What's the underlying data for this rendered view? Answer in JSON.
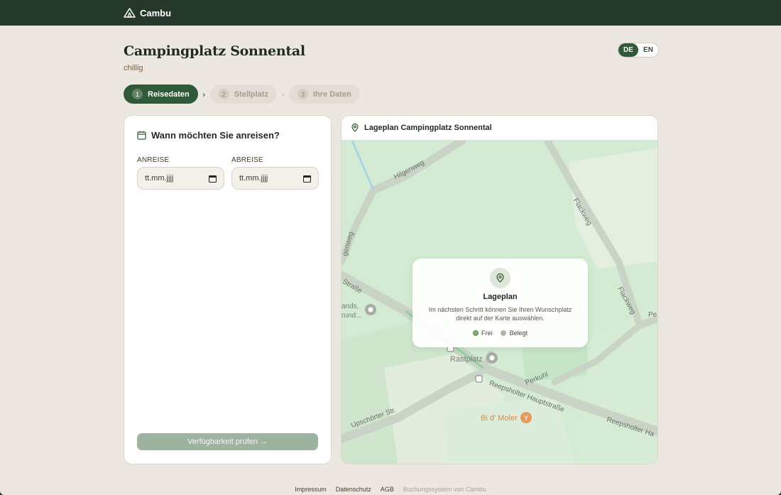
{
  "app": {
    "brand": "Cambu"
  },
  "page": {
    "title": "Campingplatz Sonnental",
    "subtitle": "chillig"
  },
  "lang": {
    "options": [
      "DE",
      "EN"
    ],
    "active": "DE"
  },
  "steps": [
    {
      "num": "1",
      "label": "Reisedaten",
      "state": "active"
    },
    {
      "num": "2",
      "label": "Stellplatz",
      "state": "inactive"
    },
    {
      "num": "3",
      "label": "Ihre Daten",
      "state": "inactive"
    }
  ],
  "dates": {
    "heading": "Wann möchten Sie anreisen?",
    "arrival_label": "ANREISE",
    "arrival_value": "tt.mm.jjjj",
    "departure_label": "ABREISE",
    "departure_value": "tt.mm.jjjj",
    "check_button": "Verfügbarkeit prüfen →"
  },
  "map": {
    "header": "Lageplan Campingplatz Sonnental",
    "streets": [
      "Hilgenweg",
      "Flackweg",
      "Flackweg",
      "Straße",
      "Perkuhl",
      "Reepsholter Hauptstraße",
      "Reepsholter Ha",
      "Upschörter Str.",
      "Pe",
      "genweg"
    ],
    "pois": [
      "Rastplatz",
      "Bi d' Moler",
      "ands,",
      "rund..."
    ],
    "overlay": {
      "title": "Lageplan",
      "text": "Im nächsten Schritt können Sie Ihren Wunschplatz direkt auf der Karte auswählen.",
      "legend_free": "Frei",
      "legend_taken": "Belegt"
    }
  },
  "colors": {
    "accent": "#2f5a37",
    "free": "#7fae6f",
    "taken": "#b8b2a6"
  },
  "footer": {
    "links": [
      "Impressum",
      "Datenschutz",
      "AGB"
    ],
    "credit": "Buchungssystem von Cambu"
  }
}
